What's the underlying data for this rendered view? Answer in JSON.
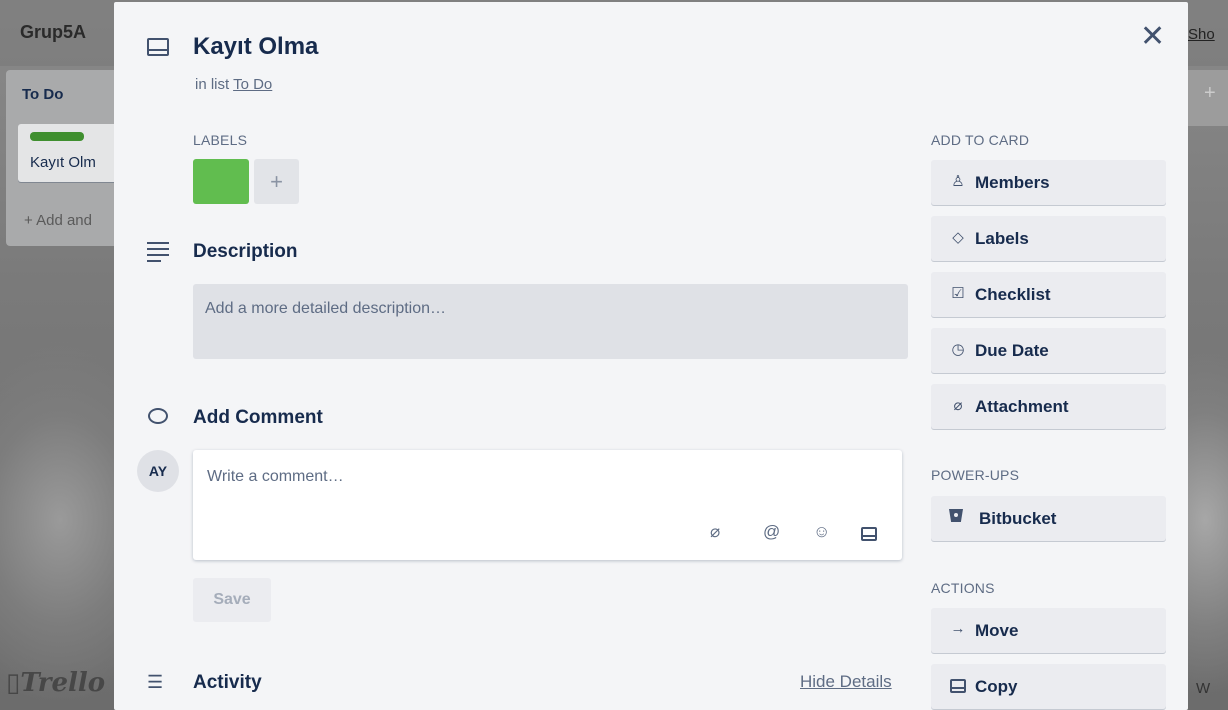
{
  "board": {
    "title": "Grup5A",
    "header_right_text": "Sho",
    "list_title": "To Do",
    "card_preview_title": "Kayıt Olm",
    "add_another": "+ Add and",
    "logo_text": "Trello",
    "bottom_right_text": "W",
    "right_col_plus": "+"
  },
  "card": {
    "title": "Kayıt Olma",
    "in_list_prefix": "in list",
    "list_name": "To Do",
    "labels_heading": "LABELS",
    "label_color": "#61bd4f",
    "add_label": "+",
    "description_heading": "Description",
    "description_placeholder": "Add a more detailed description…",
    "comment_heading": "Add Comment",
    "avatar_initials": "AY",
    "comment_placeholder": "Write a comment…",
    "save_label": "Save",
    "activity_heading": "Activity",
    "hide_details": "Hide Details",
    "close_glyph": "✕"
  },
  "sidebar": {
    "add_to_card_heading": "ADD TO CARD",
    "add_to_card": [
      {
        "label": "Members",
        "icon": "person-icon"
      },
      {
        "label": "Labels",
        "icon": "tag-icon"
      },
      {
        "label": "Checklist",
        "icon": "checkbox-icon"
      },
      {
        "label": "Due Date",
        "icon": "clock-icon"
      },
      {
        "label": "Attachment",
        "icon": "paperclip-icon"
      }
    ],
    "powerups_heading": "POWER-UPS",
    "powerups": [
      {
        "label": "Bitbucket",
        "icon": "bitbucket-icon"
      }
    ],
    "actions_heading": "ACTIONS",
    "actions": [
      {
        "label": "Move",
        "icon": "arrow-right-icon"
      },
      {
        "label": "Copy",
        "icon": "card-icon"
      }
    ]
  }
}
